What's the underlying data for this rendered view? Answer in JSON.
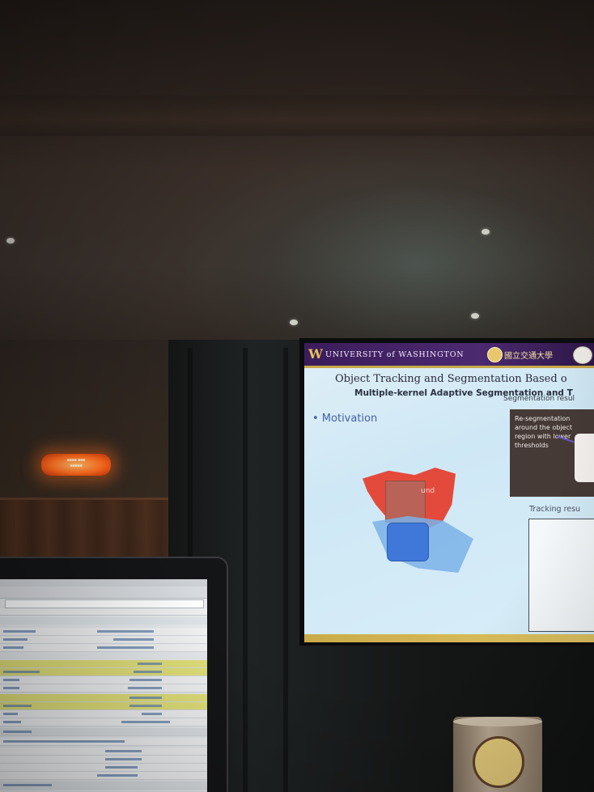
{
  "slide": {
    "header_university": "UNIVERSITY of WASHINGTON",
    "header_chinese": "國立交通大學",
    "title": "Object Tracking and Segmentation Based o",
    "subtitle": "Multiple-kernel Adaptive Segmentation and T",
    "segmentation_label": "Segmentation resul",
    "bullet": "• Motivation",
    "resegmentation_note": "Re-segmentation around the object region with lower thresholds",
    "overlay_text": "und",
    "tracking_label": "Tracking resu"
  },
  "colors": {
    "uw_purple": "#4b2a70",
    "uw_gold": "#c8a84a",
    "bullet_blue": "#4460a8",
    "red_region": "#e44a3c",
    "blue_object": "#3f78d8",
    "exit_sign": "#ff6a1c"
  },
  "icons": {
    "uw_logo": "w-logo",
    "nctu_seal": "seal-icon"
  }
}
